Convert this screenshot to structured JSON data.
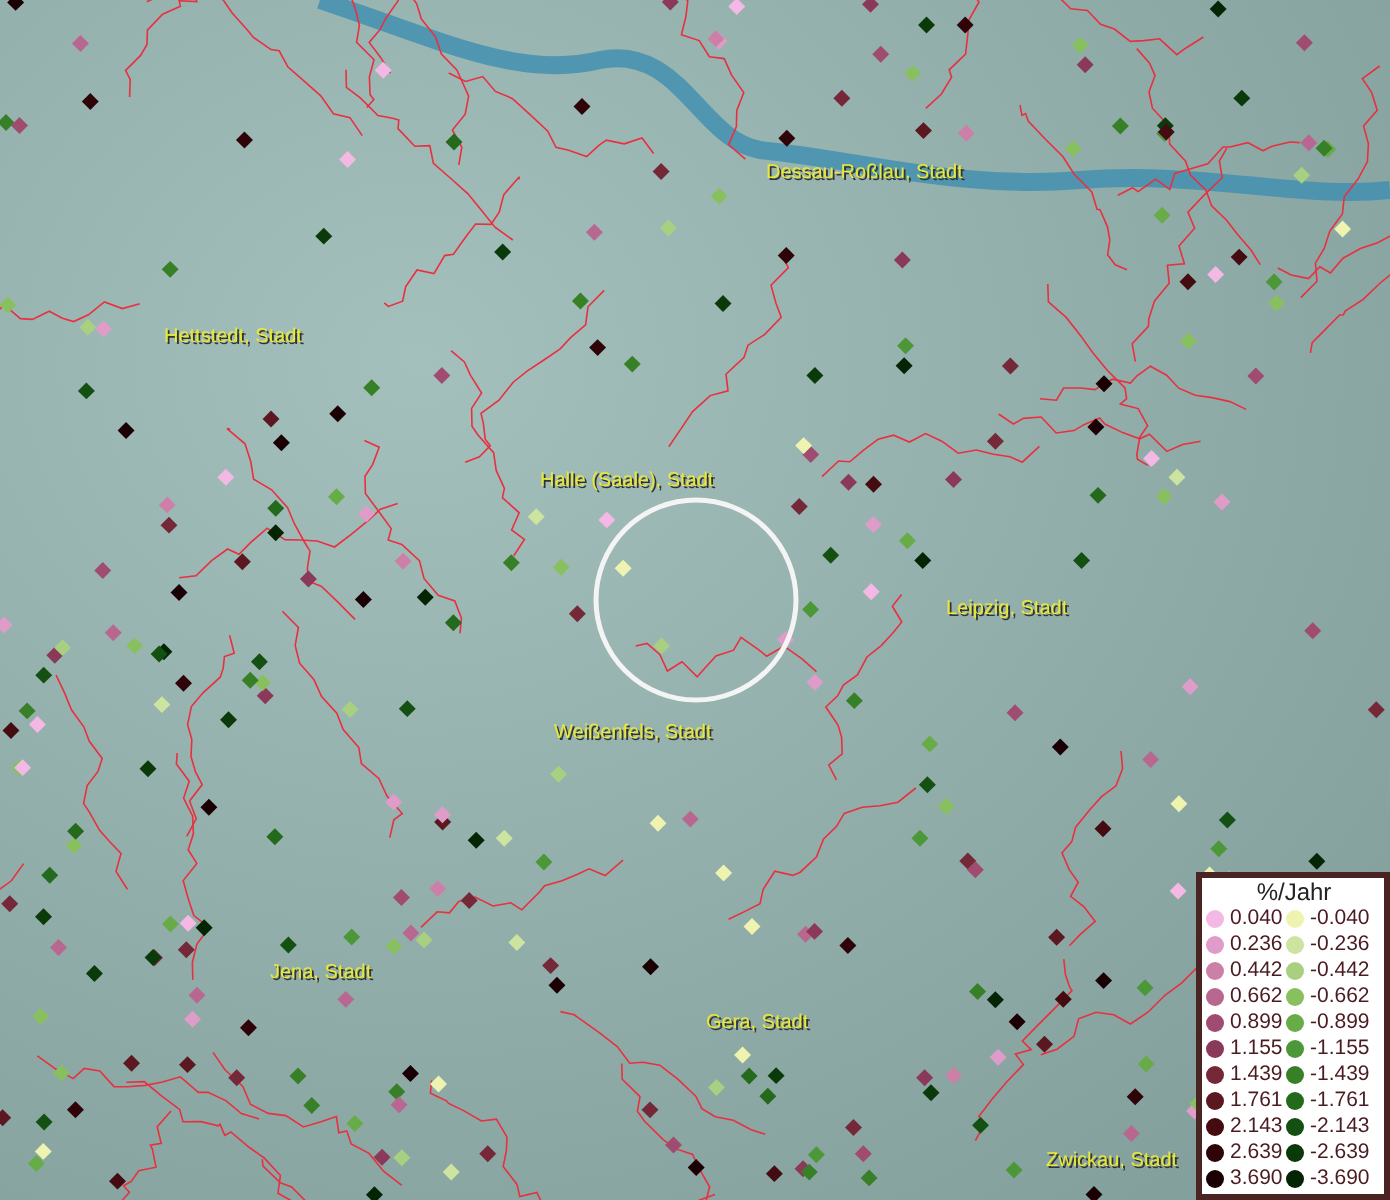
{
  "map": {
    "cities": [
      {
        "name": "Dessau-Roßlau, Stadt"
      },
      {
        "name": "Hettstedt, Stadt"
      },
      {
        "name": "Halle (Saale), Stadt"
      },
      {
        "name": "Leipzig, Stadt"
      },
      {
        "name": "Weißenfels, Stadt"
      },
      {
        "name": "Jena, Stadt"
      },
      {
        "name": "Gera, Stadt"
      },
      {
        "name": "Zwickau, Stadt"
      }
    ]
  },
  "legend": {
    "title": "%/Jahr",
    "positive": [
      {
        "label": "0.040",
        "color": "#f4b8e4"
      },
      {
        "label": "0.236",
        "color": "#e09cc8"
      },
      {
        "label": "0.442",
        "color": "#cc80a8"
      },
      {
        "label": "0.662",
        "color": "#b86890"
      },
      {
        "label": "0.899",
        "color": "#a04c70"
      },
      {
        "label": "1.155",
        "color": "#8a3a58"
      },
      {
        "label": "1.439",
        "color": "#742838"
      },
      {
        "label": "1.761",
        "color": "#5c1820"
      },
      {
        "label": "2.143",
        "color": "#440c10"
      },
      {
        "label": "2.639",
        "color": "#2e0408"
      },
      {
        "label": "3.690",
        "color": "#1a0004"
      }
    ],
    "negative": [
      {
        "label": "-0.040",
        "color": "#eef4b0"
      },
      {
        "label": "-0.236",
        "color": "#cce4a0"
      },
      {
        "label": "-0.442",
        "color": "#a8d080"
      },
      {
        "label": "-0.662",
        "color": "#88c060"
      },
      {
        "label": "-0.899",
        "color": "#68ac48"
      },
      {
        "label": "-1.155",
        "color": "#4c9838"
      },
      {
        "label": "-1.439",
        "color": "#388028"
      },
      {
        "label": "-1.761",
        "color": "#246a1c"
      },
      {
        "label": "-2.143",
        "color": "#145012"
      },
      {
        "label": "-2.639",
        "color": "#0a3a0a"
      },
      {
        "label": "-3.690",
        "color": "#042404"
      }
    ]
  }
}
